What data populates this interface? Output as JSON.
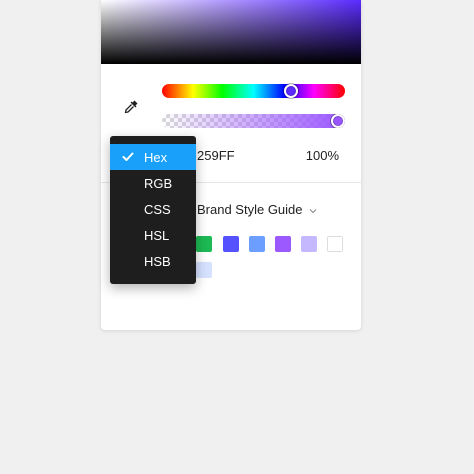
{
  "color_picker": {
    "hex_value": "259FF",
    "opacity_value": "100%",
    "hue_position": 0.72,
    "alpha_position": 1.0,
    "base_color": "#5b2bff"
  },
  "format_menu": {
    "items": [
      {
        "label": "Hex",
        "selected": true
      },
      {
        "label": "RGB",
        "selected": false
      },
      {
        "label": "CSS",
        "selected": false
      },
      {
        "label": "HSL",
        "selected": false
      },
      {
        "label": "HSB",
        "selected": false
      }
    ]
  },
  "library": {
    "name": "Brand Style Guide",
    "swatches_row1": [
      "#1db954",
      "#5551ff",
      "#6b9eff",
      "#9b59ff",
      "#c5b8ff",
      "#ffffff"
    ],
    "swatches_row2": [
      "#d6e2ff"
    ]
  },
  "icons": {
    "eyedropper": "eyedropper-icon",
    "check": "check-icon",
    "chevron": "chevron-down-icon"
  }
}
